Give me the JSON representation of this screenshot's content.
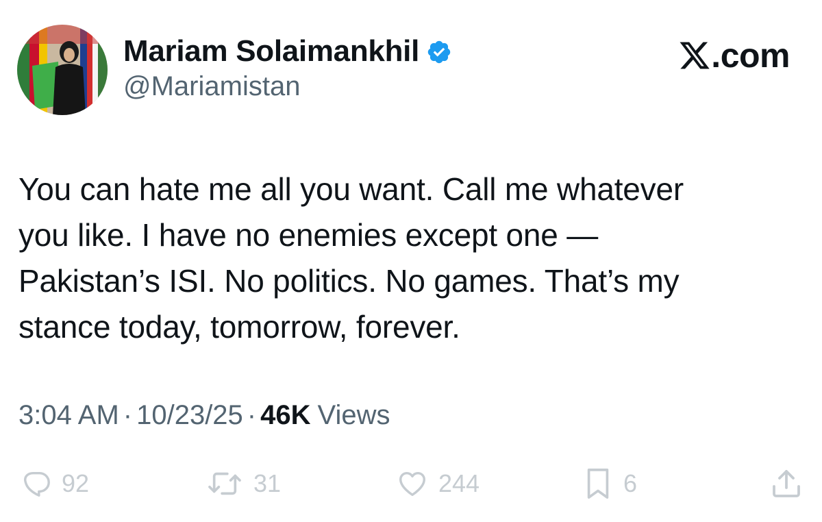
{
  "author": {
    "display_name": "Mariam Solaimankhil",
    "handle": "@Mariamistan",
    "verified": true
  },
  "brand": {
    "label": ".com"
  },
  "tweet": {
    "lines": [
      "You can hate me all you want. Call me whatever",
      "you like. I have no enemies except one —",
      "Pakistan’s ISI. No politics. No games. That’s my",
      "stance today, tomorrow, forever."
    ]
  },
  "meta": {
    "time": "3:04 AM",
    "date": "10/23/25",
    "separator": "·",
    "views_count": "46K",
    "views_label": "Views"
  },
  "actions": {
    "replies": "92",
    "reposts": "31",
    "likes": "244",
    "bookmarks": "6"
  },
  "colors": {
    "text_primary": "#0f1419",
    "text_secondary": "#536471",
    "verified_blue": "#1d9bf0",
    "action_gray": "#c6ccd1"
  }
}
